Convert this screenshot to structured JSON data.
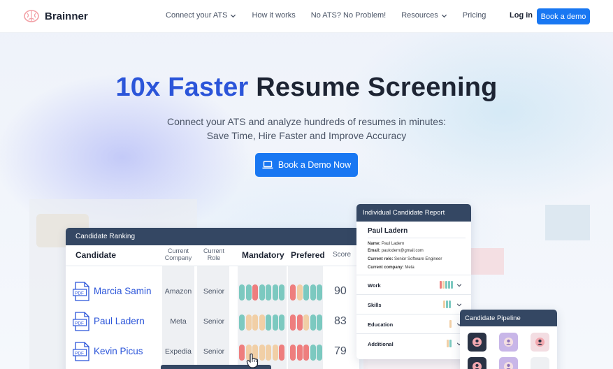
{
  "nav": {
    "brand": "Brainner",
    "links": [
      "Connect your ATS",
      "How it works",
      "No ATS? No Problem!",
      "Resources",
      "Pricing"
    ],
    "login": "Log in",
    "demo": "Book a demo"
  },
  "hero": {
    "title_accent": "10x Faster",
    "title_rest": "Resume Screening",
    "subtitle_line1": "Connect your ATS and analyze hundreds of resumes in minutes:",
    "subtitle_line2": "Save Time, Hire Faster and Improve Accuracy",
    "cta": "Book a Demo Now"
  },
  "ranking": {
    "title": "Candidate Ranking",
    "columns": {
      "candidate": "Candidate",
      "company_l1": "Current",
      "company_l2": "Company",
      "role_l1": "Current",
      "role_l2": "Role",
      "mandatory": "Mandatory",
      "preferred": "Prefered",
      "score": "Score"
    },
    "rows": [
      {
        "name": "Marcia Samin",
        "company": "Amazon",
        "role": "Senior",
        "score": "90",
        "mandatory": [
          "teal",
          "teal",
          "red",
          "teal",
          "teal",
          "teal",
          "teal"
        ],
        "preferred": [
          "red",
          "tan",
          "teal",
          "teal",
          "teal"
        ]
      },
      {
        "name": "Paul Ladern",
        "company": "Meta",
        "role": "Senior",
        "score": "83",
        "mandatory": [
          "teal",
          "tan",
          "tan",
          "tan",
          "teal",
          "teal",
          "teal"
        ],
        "preferred": [
          "red",
          "red",
          "tan",
          "teal",
          "teal"
        ]
      },
      {
        "name": "Kevin Picus",
        "company": "Expedia",
        "role": "Senior",
        "score": "79",
        "mandatory": [
          "red",
          "tan",
          "tan",
          "tan",
          "tan",
          "tan",
          "red"
        ],
        "preferred": [
          "red",
          "red",
          "red",
          "teal",
          "teal"
        ]
      }
    ]
  },
  "report": {
    "title": "Individual Candidate Report",
    "name": "Paul Ladern",
    "fields": [
      {
        "label": "Name:",
        "value": "Paul Ladern"
      },
      {
        "label": "Email:",
        "value": "paulodern@gmail.com"
      },
      {
        "label": "Current role:",
        "value": "Senior Software Engineer"
      },
      {
        "label": "Current company:",
        "value": "Meta"
      }
    ],
    "sections": [
      "Work",
      "Skills",
      "Education",
      "Additional"
    ]
  },
  "pipeline": {
    "title": "Candidate Pipeline"
  },
  "colors": {
    "teal": "#7cc9c0",
    "red": "#ee7e7e",
    "tan": "#f1cfa6",
    "accent": "#2b55d9",
    "button": "#1877f2",
    "card_header": "#344763"
  }
}
